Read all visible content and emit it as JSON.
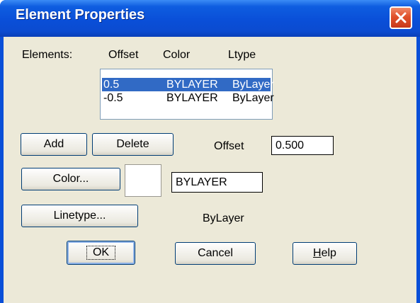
{
  "window": {
    "title": "Element Properties",
    "colors": {
      "titlebar": "#0a4fd8",
      "close_button": "#e0512a",
      "face": "#ece9d8",
      "selection": "#316ac5"
    }
  },
  "headers": {
    "elements": "Elements:",
    "offset": "Offset",
    "color": "Color",
    "ltype": "Ltype"
  },
  "elements_list": [
    {
      "offset": "0.5",
      "color": "BYLAYER",
      "ltype": "ByLayer",
      "selected": true
    },
    {
      "offset": "-0.5",
      "color": "BYLAYER",
      "ltype": "ByLayer",
      "selected": false
    }
  ],
  "buttons": {
    "add": "Add",
    "delete": "Delete",
    "color": "Color...",
    "linetype": "Linetype...",
    "ok": "OK",
    "cancel": "Cancel",
    "help_mnemonic": "H",
    "help_rest": "elp"
  },
  "offset": {
    "label": "Offset",
    "value": "0.500"
  },
  "color": {
    "value": "BYLAYER",
    "swatch": "#ffffff"
  },
  "linetype": {
    "value": "ByLayer"
  },
  "icons": {
    "close": "close-x-icon"
  }
}
